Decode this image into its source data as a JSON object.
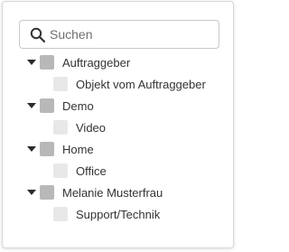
{
  "search": {
    "placeholder": "Suchen",
    "value": ""
  },
  "tree": {
    "groups": [
      {
        "label": "Auftraggeber",
        "children": [
          {
            "label": "Objekt vom Auftraggeber"
          }
        ]
      },
      {
        "label": "Demo",
        "children": [
          {
            "label": "Video"
          }
        ]
      },
      {
        "label": "Home",
        "children": [
          {
            "label": "Office"
          }
        ]
      },
      {
        "label": "Melanie Musterfrau",
        "children": [
          {
            "label": "Support/Technik"
          }
        ]
      }
    ]
  },
  "colors": {
    "parent_checkbox": "#b8b8b8",
    "child_checkbox": "#e8e8e8",
    "text": "#333333",
    "border": "#c8c8c8"
  },
  "icons": {
    "search": "search-icon",
    "expand": "caret-down-icon"
  }
}
